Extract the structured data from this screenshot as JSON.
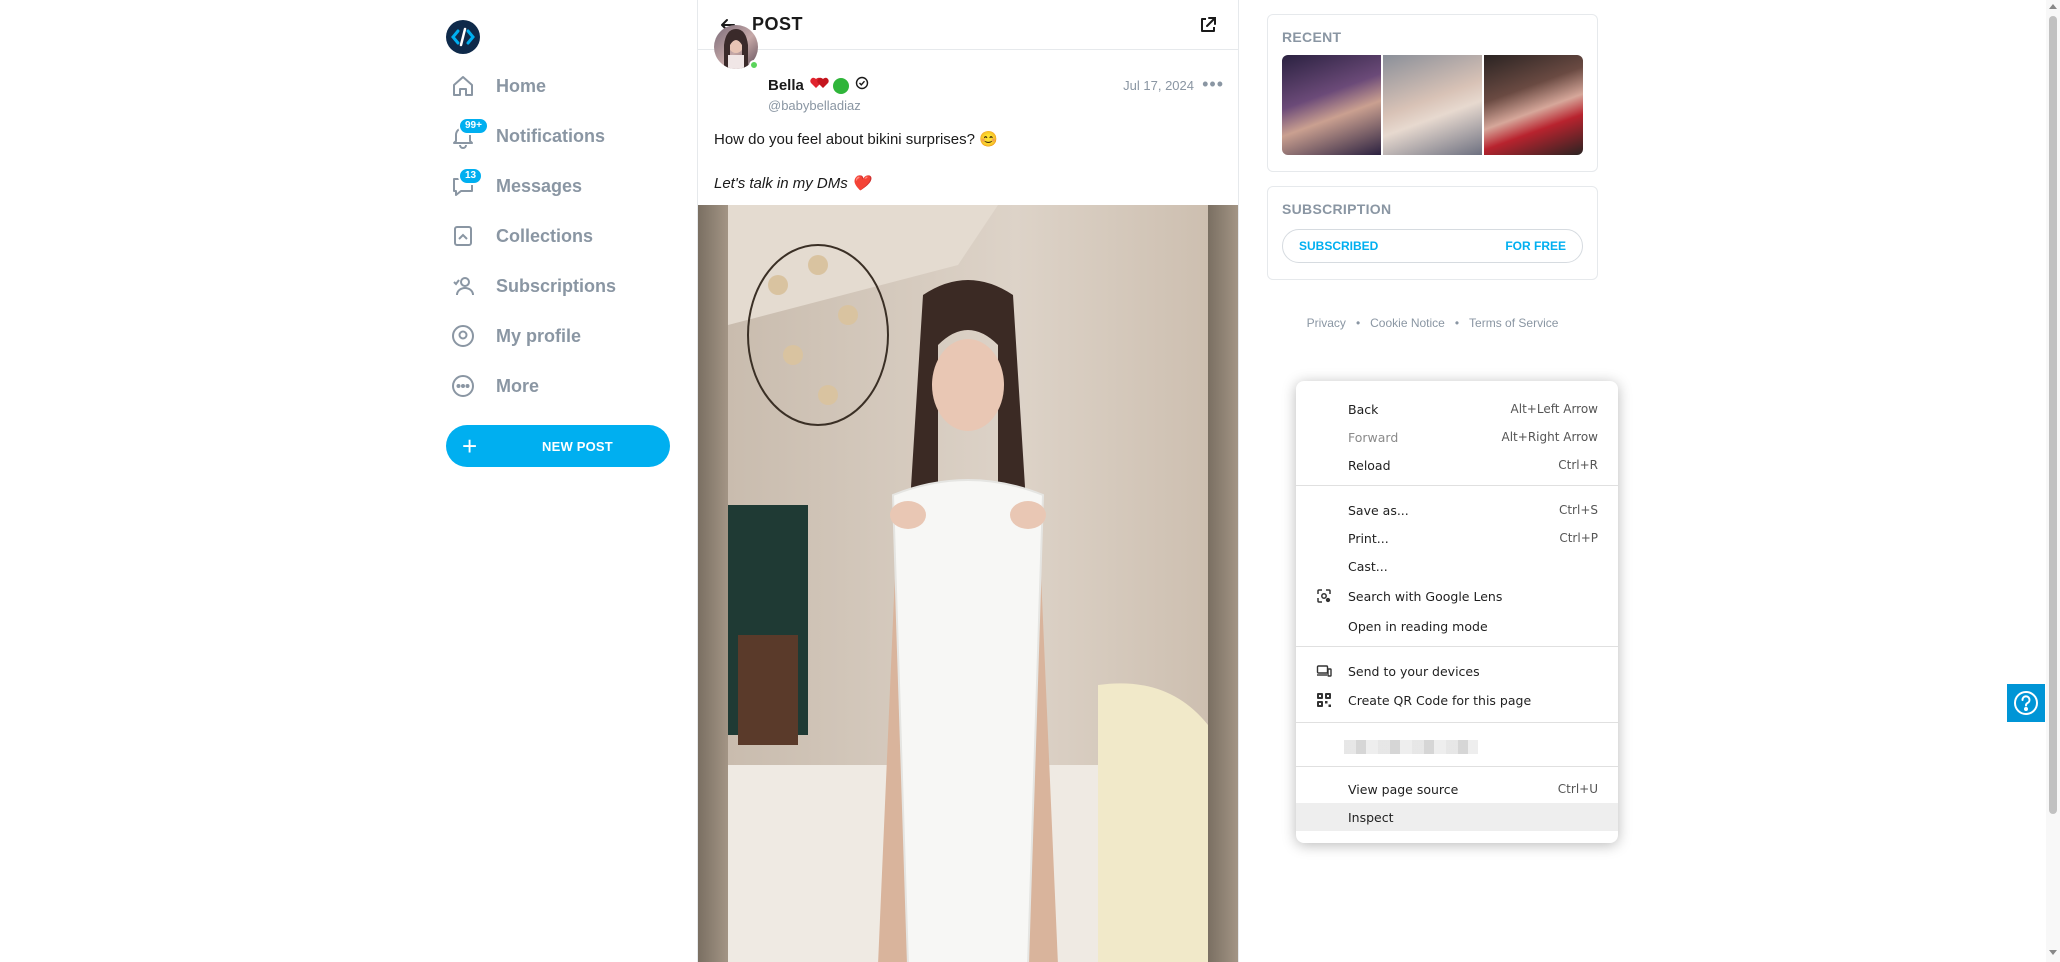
{
  "sidebar": {
    "nav": [
      {
        "label": "Home",
        "icon": "home-icon"
      },
      {
        "label": "Notifications",
        "icon": "bell-icon",
        "badge": "99+"
      },
      {
        "label": "Messages",
        "icon": "chat-icon",
        "badge": "13"
      },
      {
        "label": "Collections",
        "icon": "bookmark-icon"
      },
      {
        "label": "Subscriptions",
        "icon": "subscriptions-icon"
      },
      {
        "label": "My profile",
        "icon": "profile-icon"
      },
      {
        "label": "More",
        "icon": "more-icon"
      }
    ],
    "new_post_label": "NEW POST"
  },
  "post": {
    "header_title": "POST",
    "author_name": "Bella",
    "author_handle": "@babybelladiaz",
    "date": "Jul 17, 2024",
    "text_line1": "How do you feel about bikini surprises? 😊",
    "text_line2": "Let's talk in my DMs ❤️"
  },
  "right": {
    "recent_title": "RECENT",
    "subscription_title": "SUBSCRIPTION",
    "subscribed_label": "SUBSCRIBED",
    "price_label": "FOR FREE",
    "footer": [
      "Privacy",
      "Cookie Notice",
      "Terms of Service"
    ]
  },
  "context_menu": {
    "back": {
      "label": "Back",
      "shortcut": "Alt+Left Arrow"
    },
    "forward": {
      "label": "Forward",
      "shortcut": "Alt+Right Arrow"
    },
    "reload": {
      "label": "Reload",
      "shortcut": "Ctrl+R"
    },
    "save_as": {
      "label": "Save as...",
      "shortcut": "Ctrl+S"
    },
    "print": {
      "label": "Print...",
      "shortcut": "Ctrl+P"
    },
    "cast": {
      "label": "Cast..."
    },
    "lens": {
      "label": "Search with Google Lens"
    },
    "reading_mode": {
      "label": "Open in reading mode"
    },
    "send_devices": {
      "label": "Send to your devices"
    },
    "qr_code": {
      "label": "Create QR Code for this page"
    },
    "view_source": {
      "label": "View page source",
      "shortcut": "Ctrl+U"
    },
    "inspect": {
      "label": "Inspect"
    }
  },
  "colors": {
    "accent": "#00aff0",
    "nav_text": "#8a96a3",
    "help_button": "#0095d6"
  }
}
